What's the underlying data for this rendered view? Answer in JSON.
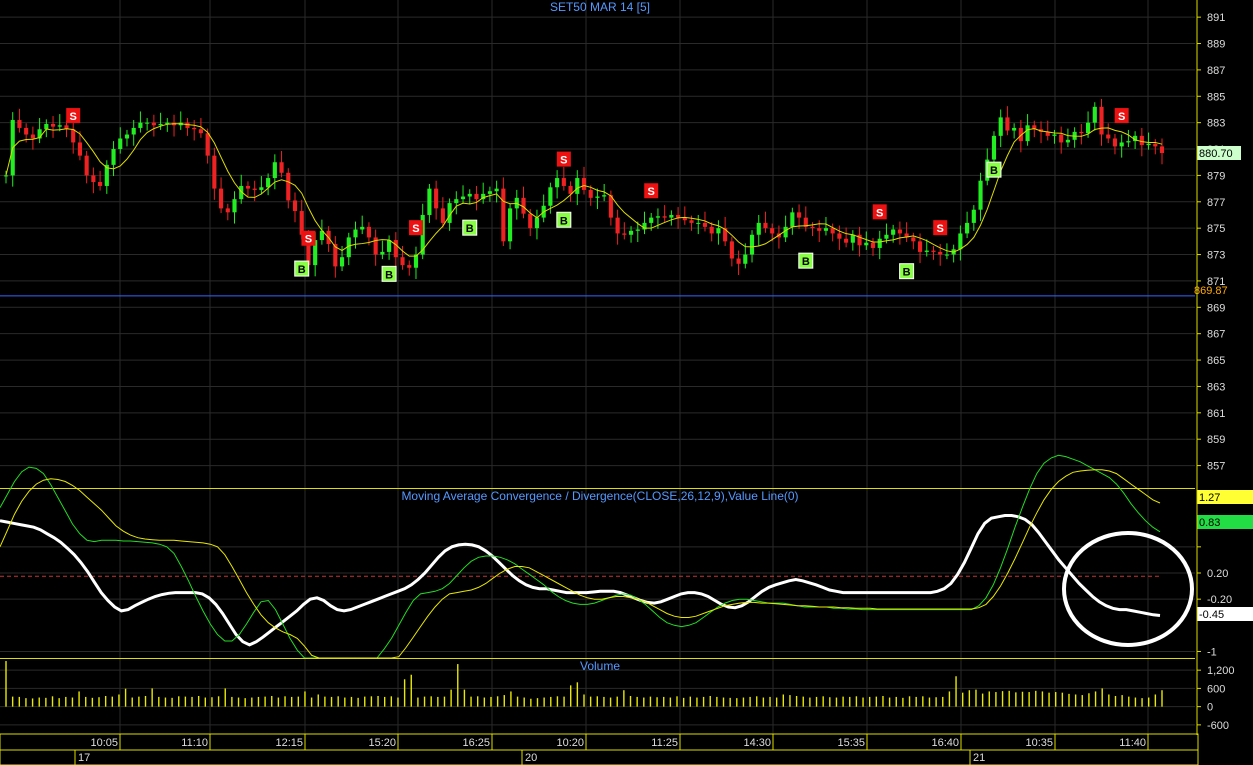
{
  "chart_data": [
    {
      "type": "candlestick",
      "title": "SET50 MAR 14   [5]",
      "ylim": [
        855.3,
        892.3
      ],
      "y_ticks": [
        "891",
        "889",
        "887",
        "885",
        "883",
        "881",
        "879",
        "877",
        "875",
        "873",
        "871",
        "869",
        "867",
        "865",
        "863",
        "861",
        "859",
        "857"
      ],
      "last_price": "880.70",
      "reference_line": {
        "label": "869.87",
        "value": 869.87
      },
      "ohlc_close_estimate": [
        879.0,
        883.2,
        882.6,
        882.1,
        881.8,
        882.5,
        882.9,
        882.7,
        882.8,
        882.5,
        881.5,
        880.5,
        879.0,
        878.5,
        878.2,
        879.8,
        881.0,
        881.8,
        882.1,
        882.6,
        883.0,
        883.0,
        882.8,
        882.9,
        883.0,
        882.8,
        883.0,
        882.6,
        882.5,
        882.2,
        880.5,
        878.0,
        876.5,
        876.2,
        877.2,
        878.2,
        878.0,
        877.9,
        878.1,
        878.8,
        880.0,
        879.2,
        877.1,
        876.3,
        874.5,
        872.2,
        874.1,
        874.8,
        873.8,
        872.1,
        872.8,
        874.3,
        874.9,
        875.1,
        874.3,
        873.0,
        873.2,
        874.1,
        872.8,
        872.2,
        872.0,
        873.0,
        876.0,
        878.0,
        876.5,
        875.4,
        876.9,
        877.2,
        877.4,
        877.6,
        877.2,
        877.6,
        877.8,
        878.0,
        874.0,
        876.5,
        877.3,
        876.1,
        875.0,
        875.8,
        876.7,
        878.1,
        878.8,
        878.2,
        877.6,
        878.8,
        877.9,
        877.3,
        877.4,
        877.5,
        875.8,
        874.6,
        874.5,
        874.8,
        874.9,
        875.4,
        875.8,
        875.9,
        875.8,
        876.0,
        875.8,
        875.6,
        875.4,
        875.4,
        875.1,
        874.6,
        875.0,
        874.0,
        872.7,
        872.3,
        873.0,
        874.5,
        875.4,
        875.0,
        874.6,
        874.3,
        875.1,
        876.2,
        875.8,
        875.1,
        875.0,
        874.8,
        875.0,
        874.6,
        874.2,
        873.9,
        874.5,
        873.7,
        873.9,
        873.5,
        874.2,
        874.5,
        874.9,
        874.6,
        874.3,
        874.0,
        873.2,
        873.3,
        873.2,
        873.0,
        873.0,
        873.4,
        874.6,
        875.4,
        876.4,
        878.6,
        880.2,
        882.0,
        883.4,
        882.4,
        882.6,
        881.6,
        882.8,
        882.5,
        882.3,
        882.0,
        882.1,
        881.5,
        881.7,
        882.3,
        882.2,
        883.0,
        884.2,
        882.1,
        881.8,
        881.2,
        881.5,
        881.6,
        882.0,
        881.3,
        881.4,
        881.2,
        880.7
      ],
      "markers": [
        {
          "type": "S",
          "label": "S",
          "close_index": 10
        },
        {
          "type": "B",
          "label": "B",
          "close_index": 44
        },
        {
          "type": "S",
          "label": "S",
          "close_index": 45
        },
        {
          "type": "B",
          "label": "B",
          "close_index": 57
        },
        {
          "type": "S",
          "label": "S",
          "close_index": 61
        },
        {
          "type": "B",
          "label": "B",
          "close_index": 69
        },
        {
          "type": "B",
          "label": "B",
          "close_index": 83
        },
        {
          "type": "S",
          "label": "S",
          "close_index": 83
        },
        {
          "type": "S",
          "label": "S",
          "close_index": 96
        },
        {
          "type": "B",
          "label": "B",
          "close_index": 119
        },
        {
          "type": "S",
          "label": "S",
          "close_index": 130
        },
        {
          "type": "B",
          "label": "B",
          "close_index": 134
        },
        {
          "type": "S",
          "label": "S",
          "close_index": 139
        },
        {
          "type": "B",
          "label": "B",
          "close_index": 147
        },
        {
          "type": "S",
          "label": "S",
          "close_index": 166
        }
      ]
    },
    {
      "type": "line",
      "title": "Moving Average Convergence / Divergence(CLOSE,26,12,9),Value Line(0)",
      "ylim": [
        -1.1,
        1.5
      ],
      "y_ticks": [
        "0.20",
        "-0.20",
        "-1"
      ],
      "value_labels": [
        {
          "label": "1.27",
          "color": "#ffff00"
        },
        {
          "label": "0.83",
          "color": "#22dd22"
        },
        {
          "label": "-0.45",
          "color": "#ffffff"
        }
      ],
      "value_line": 0.15,
      "series": [
        {
          "color": "#ffffff",
          "values": [
            1.0,
            0.98,
            0.96,
            0.94,
            0.92,
            0.9,
            0.86,
            0.8,
            0.74,
            0.67,
            0.58,
            0.48,
            0.36,
            0.22,
            0.06,
            -0.1,
            -0.22,
            -0.32,
            -0.38,
            -0.36,
            -0.3,
            -0.25,
            -0.2,
            -0.16,
            -0.13,
            -0.11,
            -0.1,
            -0.1,
            -0.1,
            -0.1,
            -0.12,
            -0.18,
            -0.28,
            -0.42,
            -0.58,
            -0.74,
            -0.85,
            -0.9,
            -0.85,
            -0.78,
            -0.7,
            -0.62,
            -0.54,
            -0.46,
            -0.38,
            -0.28,
            -0.2,
            -0.18,
            -0.22,
            -0.3,
            -0.36,
            -0.38,
            -0.36,
            -0.32,
            -0.28,
            -0.24,
            -0.2,
            -0.16,
            -0.12,
            -0.08,
            -0.04,
            0.02,
            0.1,
            0.2,
            0.32,
            0.44,
            0.54,
            0.6,
            0.63,
            0.64,
            0.63,
            0.6,
            0.54,
            0.46,
            0.36,
            0.26,
            0.16,
            0.08,
            0.02,
            -0.02,
            -0.04,
            -0.04,
            -0.06,
            -0.08,
            -0.1,
            -0.1,
            -0.1,
            -0.1,
            -0.09,
            -0.08,
            -0.08,
            -0.08,
            -0.1,
            -0.14,
            -0.18,
            -0.22,
            -0.25,
            -0.26,
            -0.24,
            -0.2,
            -0.16,
            -0.12,
            -0.1,
            -0.1,
            -0.12,
            -0.16,
            -0.22,
            -0.28,
            -0.32,
            -0.33,
            -0.3,
            -0.24,
            -0.16,
            -0.08,
            -0.02,
            0.02,
            0.05,
            0.08,
            0.1,
            0.08,
            0.05,
            0.02,
            -0.02,
            -0.06,
            -0.08,
            -0.1,
            -0.1,
            -0.1,
            -0.1,
            -0.1,
            -0.1,
            -0.1,
            -0.1,
            -0.1,
            -0.1,
            -0.1,
            -0.1,
            -0.1,
            -0.1,
            -0.08,
            -0.04,
            0.04,
            0.18,
            0.36,
            0.58,
            0.8,
            0.96,
            1.04,
            1.06,
            1.08,
            1.08,
            1.06,
            1.02,
            0.94,
            0.82,
            0.68,
            0.54,
            0.4,
            0.28,
            0.16,
            0.04,
            -0.06,
            -0.16,
            -0.24,
            -0.3,
            -0.34,
            -0.36,
            -0.36,
            -0.38,
            -0.4,
            -0.42,
            -0.44,
            -0.45
          ]
        },
        {
          "color": "#22dd22",
          "values": [
            1.2,
            1.4,
            1.6,
            1.75,
            1.82,
            1.8,
            1.72,
            1.55,
            1.35,
            1.15,
            0.95,
            0.8,
            0.7,
            0.68,
            0.7,
            0.7,
            0.7,
            0.69,
            0.69,
            0.68,
            0.67,
            0.66,
            0.64,
            0.6,
            0.5,
            0.3,
            0.08,
            -0.16,
            -0.38,
            -0.58,
            -0.74,
            -0.84,
            -0.84,
            -0.74,
            -0.58,
            -0.4,
            -0.24,
            -0.22,
            -0.36,
            -0.58,
            -0.8,
            -0.98,
            -1.12,
            -1.22,
            -1.3,
            -1.3,
            -1.3,
            -1.3,
            -1.3,
            -1.3,
            -1.3,
            -1.22,
            -1.1,
            -0.96,
            -0.8,
            -0.6,
            -0.4,
            -0.22,
            -0.12,
            -0.1,
            -0.08,
            -0.04,
            0.04,
            0.16,
            0.28,
            0.38,
            0.44,
            0.46,
            0.46,
            0.44,
            0.4,
            0.34,
            0.26,
            0.18,
            0.1,
            0.02,
            -0.08,
            -0.16,
            -0.22,
            -0.26,
            -0.28,
            -0.28,
            -0.26,
            -0.22,
            -0.18,
            -0.14,
            -0.12,
            -0.14,
            -0.2,
            -0.28,
            -0.38,
            -0.48,
            -0.56,
            -0.6,
            -0.62,
            -0.6,
            -0.56,
            -0.48,
            -0.4,
            -0.32,
            -0.26,
            -0.22,
            -0.2,
            -0.2,
            -0.22,
            -0.24,
            -0.26,
            -0.26,
            -0.26,
            -0.28,
            -0.3,
            -0.32,
            -0.32,
            -0.32,
            -0.32,
            -0.34,
            -0.34,
            -0.35,
            -0.35,
            -0.36,
            -0.36,
            -0.36,
            -0.36,
            -0.36,
            -0.36,
            -0.36,
            -0.36,
            -0.36,
            -0.36,
            -0.36,
            -0.36,
            -0.36,
            -0.36,
            -0.36,
            -0.36,
            -0.3,
            -0.18,
            0.02,
            0.28,
            0.58,
            0.9,
            1.2,
            1.48,
            1.72,
            1.88,
            1.96,
            2.0,
            1.98,
            1.94,
            1.9,
            1.84,
            1.78,
            1.72,
            1.66,
            1.56,
            1.42,
            1.26,
            1.12,
            1.0,
            0.9,
            0.83
          ]
        },
        {
          "color": "#e8e800",
          "values": [
            0.6,
            0.85,
            1.1,
            1.3,
            1.45,
            1.56,
            1.62,
            1.64,
            1.63,
            1.6,
            1.54,
            1.46,
            1.36,
            1.26,
            1.16,
            1.04,
            0.92,
            0.84,
            0.78,
            0.74,
            0.72,
            0.71,
            0.7,
            0.7,
            0.7,
            0.69,
            0.68,
            0.67,
            0.66,
            0.64,
            0.6,
            0.48,
            0.3,
            0.1,
            -0.1,
            -0.28,
            -0.44,
            -0.56,
            -0.64,
            -0.7,
            -0.74,
            -0.8,
            -0.92,
            -1.06,
            -1.2,
            -1.3,
            -1.3,
            -1.3,
            -1.3,
            -1.3,
            -1.3,
            -1.3,
            -1.3,
            -1.28,
            -1.2,
            -1.08,
            -0.94,
            -0.78,
            -0.62,
            -0.46,
            -0.32,
            -0.2,
            -0.12,
            -0.1,
            -0.08,
            -0.06,
            -0.02,
            0.04,
            0.12,
            0.2,
            0.26,
            0.3,
            0.3,
            0.28,
            0.22,
            0.16,
            0.1,
            0.04,
            -0.02,
            -0.08,
            -0.14,
            -0.18,
            -0.2,
            -0.2,
            -0.18,
            -0.16,
            -0.16,
            -0.18,
            -0.2,
            -0.24,
            -0.3,
            -0.36,
            -0.42,
            -0.46,
            -0.48,
            -0.48,
            -0.46,
            -0.42,
            -0.38,
            -0.34,
            -0.3,
            -0.28,
            -0.26,
            -0.25,
            -0.25,
            -0.26,
            -0.26,
            -0.27,
            -0.28,
            -0.29,
            -0.3,
            -0.3,
            -0.31,
            -0.32,
            -0.32,
            -0.32,
            -0.33,
            -0.33,
            -0.34,
            -0.34,
            -0.34,
            -0.35,
            -0.35,
            -0.35,
            -0.35,
            -0.35,
            -0.35,
            -0.35,
            -0.35,
            -0.35,
            -0.35,
            -0.35,
            -0.35,
            -0.35,
            -0.35,
            -0.33,
            -0.28,
            -0.16,
            0.0,
            0.2,
            0.42,
            0.66,
            0.9,
            1.12,
            1.32,
            1.48,
            1.6,
            1.68,
            1.74,
            1.76,
            1.77,
            1.78,
            1.78,
            1.76,
            1.72,
            1.64,
            1.56,
            1.48,
            1.4,
            1.32,
            1.27
          ]
        }
      ]
    },
    {
      "type": "bar",
      "title": "Volume",
      "ylim": [
        -900,
        1600
      ],
      "y_ticks": [
        "1,200",
        "600",
        "0",
        "-600"
      ],
      "values": [
        1500,
        330,
        320,
        280,
        270,
        300,
        290,
        340,
        280,
        320,
        300,
        500,
        320,
        290,
        310,
        350,
        330,
        400,
        590,
        300,
        330,
        350,
        600,
        320,
        300,
        290,
        340,
        330,
        320,
        350,
        300,
        310,
        340,
        600,
        320,
        300,
        280,
        300,
        320,
        330,
        350,
        300,
        340,
        320,
        330,
        500,
        300,
        400,
        330,
        320,
        340,
        300,
        320,
        290,
        330,
        340,
        350,
        320,
        340,
        300,
        900,
        1050,
        300,
        330,
        340,
        320,
        330,
        560,
        1400,
        560,
        330,
        340,
        300,
        320,
        340,
        380,
        500,
        330,
        300,
        260,
        280,
        300,
        320,
        340,
        330,
        700,
        800,
        400,
        330,
        340,
        320,
        300,
        330,
        540,
        350,
        320,
        300,
        330,
        310,
        320,
        300,
        340,
        290,
        330,
        300,
        320,
        350,
        320,
        300,
        290,
        280,
        300,
        320,
        340,
        300,
        320,
        300,
        400,
        380,
        350,
        330,
        300,
        320,
        340,
        310,
        300,
        330,
        320,
        340,
        300,
        320,
        330,
        350,
        300,
        320,
        290,
        340,
        320,
        340,
        300,
        310,
        320,
        500,
        1000,
        460,
        540,
        560,
        430,
        500,
        480,
        510,
        520,
        470,
        490,
        480,
        520,
        500,
        460,
        480,
        460,
        420,
        400,
        380,
        440,
        500,
        600,
        400,
        350,
        380,
        330,
        300,
        280,
        300,
        400,
        540
      ]
    }
  ],
  "time_axis": {
    "ticks": [
      "10:05",
      "11:10",
      "12:15",
      "15:20",
      "16:25",
      "10:20",
      "11:25",
      "14:30",
      "15:35",
      "16:40",
      "10:35",
      "11:40"
    ],
    "days": [
      "17",
      "20",
      "21"
    ]
  }
}
